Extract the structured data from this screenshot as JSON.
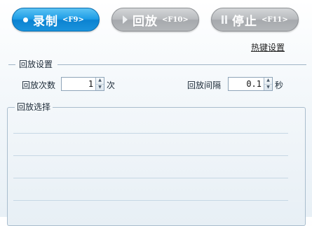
{
  "toolbar": {
    "record": {
      "label": "录制",
      "key": "<F9>"
    },
    "replay": {
      "label": "回放",
      "key": "<F10>"
    },
    "stop": {
      "label": "停止",
      "key": "<F11>"
    }
  },
  "hotkey_link": "热键设置",
  "playback_settings": {
    "title": "回放设置",
    "count_label": "回放次数",
    "count_value": "1",
    "count_unit": "次",
    "interval_label": "回放间隔",
    "interval_value": "0.1",
    "interval_unit": "秒"
  },
  "playback_selection": {
    "title": "回放选择"
  },
  "colors": {
    "record_button": "#1d9ce6",
    "disabled_button": "#b3b6b9",
    "group_border": "#a9bdcd"
  }
}
